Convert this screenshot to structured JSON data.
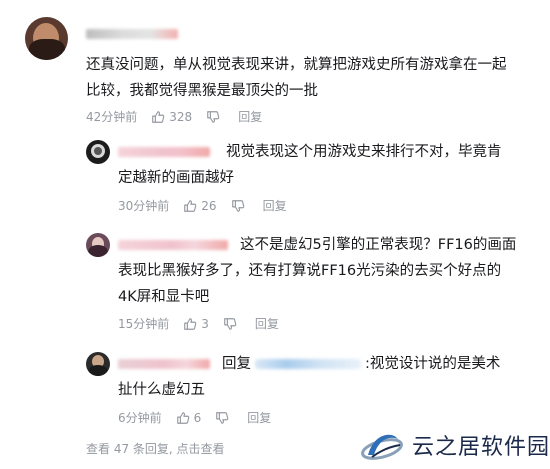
{
  "comments": [
    {
      "text_lines": [
        "还真没问题，单从视觉表现来讲，就算把游戏史所有游戏拿在一起",
        "比较，我都觉得黑猴是最顶尖的一批"
      ],
      "time": "42分钟前",
      "likes": "328",
      "reply_label": "回复"
    },
    {
      "text_lines": [
        "视觉表现这个用游戏史来排行不对，毕竟肯",
        "定越新的画面越好"
      ],
      "time": "30分钟前",
      "likes": "26",
      "reply_label": "回复"
    },
    {
      "text_lines": [
        "这不是虚幻5引擎的正常表现？FF16的画面",
        "表现比黑猴好多了，还有打算说FF16光污染的去买个好点的",
        "4K屏和显卡吧"
      ],
      "time": "15分钟前",
      "likes": "3",
      "reply_label": "回复"
    },
    {
      "reply_prefix": "回复",
      "text_after_mention": ":视觉设计说的是美术",
      "text_line2": "扯什么虚幻五",
      "time": "6分钟前",
      "likes": "6",
      "reply_label": "回复"
    }
  ],
  "footer": {
    "text": "查看 47 条回复, 点击查看"
  },
  "watermark": {
    "text": "云之居软件园"
  },
  "icons": {
    "like": "thumb-up-icon",
    "dislike": "thumb-down-icon",
    "logo": "swoosh-logo-icon"
  }
}
